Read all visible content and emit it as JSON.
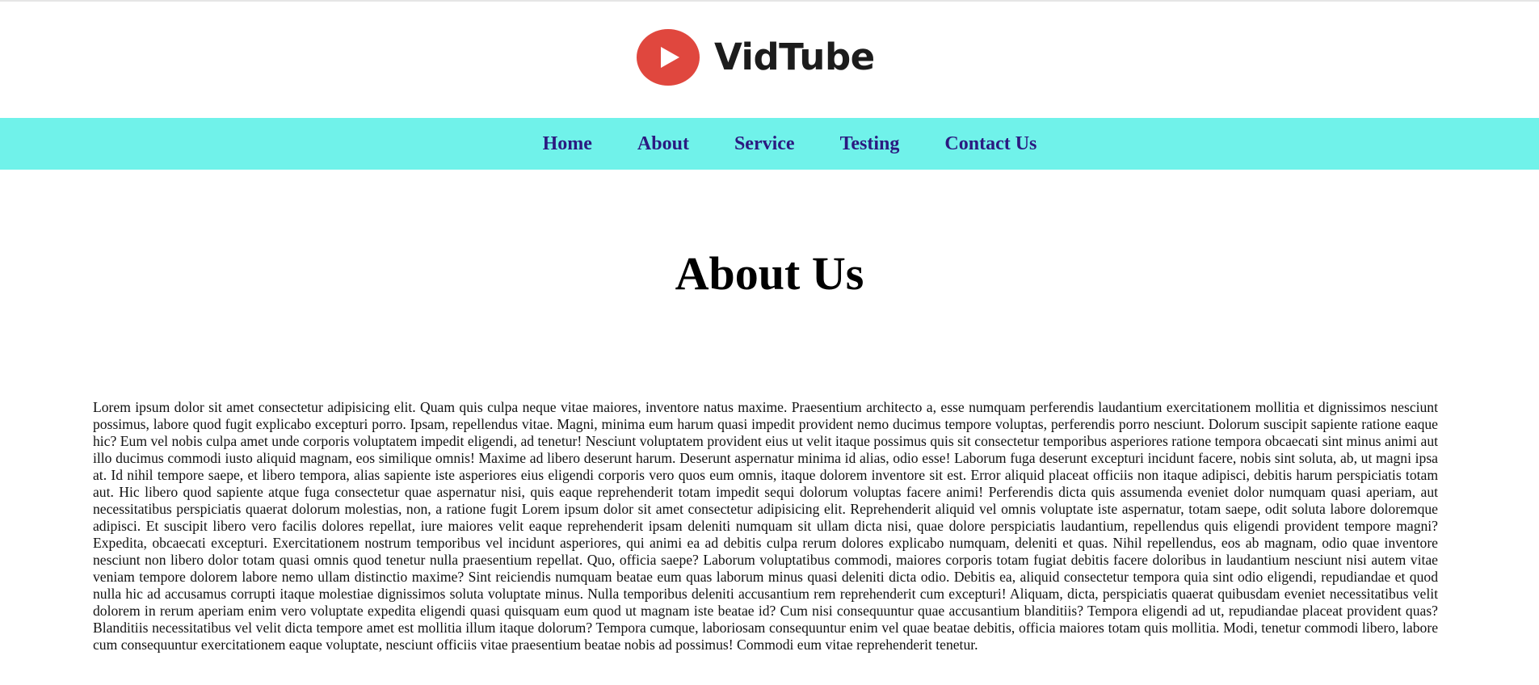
{
  "brand": {
    "name": "VidTube",
    "icon": "play-circle-icon",
    "icon_color": "#e0473e"
  },
  "nav": {
    "background": "#70f2ea",
    "link_color": "#2b1a80",
    "items": [
      {
        "label": "Home"
      },
      {
        "label": "About"
      },
      {
        "label": "Service"
      },
      {
        "label": "Testing"
      },
      {
        "label": "Contact Us"
      }
    ]
  },
  "main": {
    "title": "About Us",
    "body": "Lorem ipsum dolor sit amet consectetur adipisicing elit. Quam quis culpa neque vitae maiores, inventore natus maxime. Praesentium architecto a, esse numquam perferendis laudantium exercitationem mollitia et dignissimos nesciunt possimus, labore quod fugit explicabo excepturi porro. Ipsam, repellendus vitae. Magni, minima eum harum quasi impedit provident nemo ducimus tempore voluptas, perferendis porro nesciunt. Dolorum suscipit sapiente ratione eaque hic? Eum vel nobis culpa amet unde corporis voluptatem impedit eligendi, ad tenetur! Nesciunt voluptatem provident eius ut velit itaque possimus quis sit consectetur temporibus asperiores ratione tempora obcaecati sint minus animi aut illo ducimus commodi iusto aliquid magnam, eos similique omnis! Maxime ad libero deserunt harum. Deserunt aspernatur minima id alias, odio esse! Laborum fuga deserunt excepturi incidunt facere, nobis sint soluta, ab, ut magni ipsa at. Id nihil tempore saepe, et libero tempora, alias sapiente iste asperiores eius eligendi corporis vero quos eum omnis, itaque dolorem inventore sit est. Error aliquid placeat officiis non itaque adipisci, debitis harum perspiciatis totam aut. Hic libero quod sapiente atque fuga consectetur quae aspernatur nisi, quis eaque reprehenderit totam impedit sequi dolorum voluptas facere animi! Perferendis dicta quis assumenda eveniet dolor numquam quasi aperiam, aut necessitatibus perspiciatis quaerat dolorum molestias, non, a ratione fugit Lorem ipsum dolor sit amet consectetur adipisicing elit. Reprehenderit aliquid vel omnis voluptate iste aspernatur, totam saepe, odit soluta labore doloremque adipisci. Et suscipit libero vero facilis dolores repellat, iure maiores velit eaque reprehenderit ipsam deleniti numquam sit ullam dicta nisi, quae dolore perspiciatis laudantium, repellendus quis eligendi provident tempore magni? Expedita, obcaecati excepturi. Exercitationem nostrum temporibus vel incidunt asperiores, qui animi ea ad debitis culpa rerum dolores explicabo numquam, deleniti et quas. Nihil repellendus, eos ab magnam, odio quae inventore nesciunt non libero dolor totam quasi omnis quod tenetur nulla praesentium repellat. Quo, officia saepe? Laborum voluptatibus commodi, maiores corporis totam fugiat debitis facere doloribus in laudantium nesciunt nisi autem vitae veniam tempore dolorem labore nemo ullam distinctio maxime? Sint reiciendis numquam beatae eum quas laborum minus quasi deleniti dicta odio. Debitis ea, aliquid consectetur tempora quia sint odio eligendi, repudiandae et quod nulla hic ad accusamus corrupti itaque molestiae dignissimos soluta voluptate minus. Nulla temporibus deleniti accusantium rem reprehenderit cum excepturi! Aliquam, dicta, perspiciatis quaerat quibusdam eveniet necessitatibus velit dolorem in rerum aperiam enim vero voluptate expedita eligendi quasi quisquam eum quod ut magnam iste beatae id? Cum nisi consequuntur quae accusantium blanditiis? Tempora eligendi ad ut, repudiandae placeat provident quas? Blanditiis necessitatibus vel velit dicta tempore amet est mollitia illum itaque dolorum? Tempora cumque, laboriosam consequuntur enim vel quae beatae debitis, officia maiores totam quis mollitia. Modi, tenetur commodi libero, labore cum consequuntur exercitationem eaque voluptate, nesciunt officiis vitae praesentium beatae nobis ad possimus! Commodi eum vitae reprehenderit tenetur."
  }
}
